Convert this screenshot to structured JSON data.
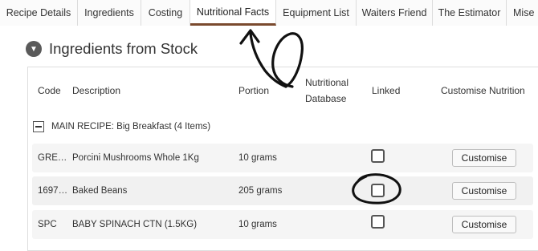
{
  "tabs": [
    {
      "label": "Recipe Details",
      "active": false
    },
    {
      "label": "Ingredients",
      "active": false
    },
    {
      "label": "Costing",
      "active": false
    },
    {
      "label": "Nutritional Facts",
      "active": true
    },
    {
      "label": "Equipment List",
      "active": false
    },
    {
      "label": "Waiters Friend",
      "active": false
    },
    {
      "label": "The Estimator",
      "active": false
    },
    {
      "label": "Mise",
      "active": false
    }
  ],
  "section": {
    "title": "Ingredients from Stock",
    "collapse_icon": "chevron-down-icon"
  },
  "table": {
    "headers": {
      "code": "Code",
      "description": "Description",
      "portion": "Portion",
      "nutritional_database_line1": "Nutritional",
      "nutritional_database_line2": "Database",
      "linked": "Linked",
      "customise_nutrition": "Customise Nutrition"
    },
    "group": {
      "label": "MAIN RECIPE: Big Breakfast (4 Items)",
      "toggle_icon": "minus-icon"
    },
    "rows": [
      {
        "code": "GRE…",
        "description": "Porcini Mushrooms Whole 1Kg",
        "portion": "10 grams",
        "nutritional_database": "",
        "linked": false,
        "button": "Customise"
      },
      {
        "code": "1697…",
        "description": "Baked Beans",
        "portion": "205 grams",
        "nutritional_database": "",
        "linked": false,
        "button": "Customise"
      },
      {
        "code": "SPC",
        "description": "BABY SPINACH CTN (1.5KG)",
        "portion": "10 grams",
        "nutritional_database": "",
        "linked": false,
        "button": "Customise"
      }
    ]
  },
  "colors": {
    "active_tab_underline": "#7a4a2e",
    "annotation_ink": "#111111"
  }
}
